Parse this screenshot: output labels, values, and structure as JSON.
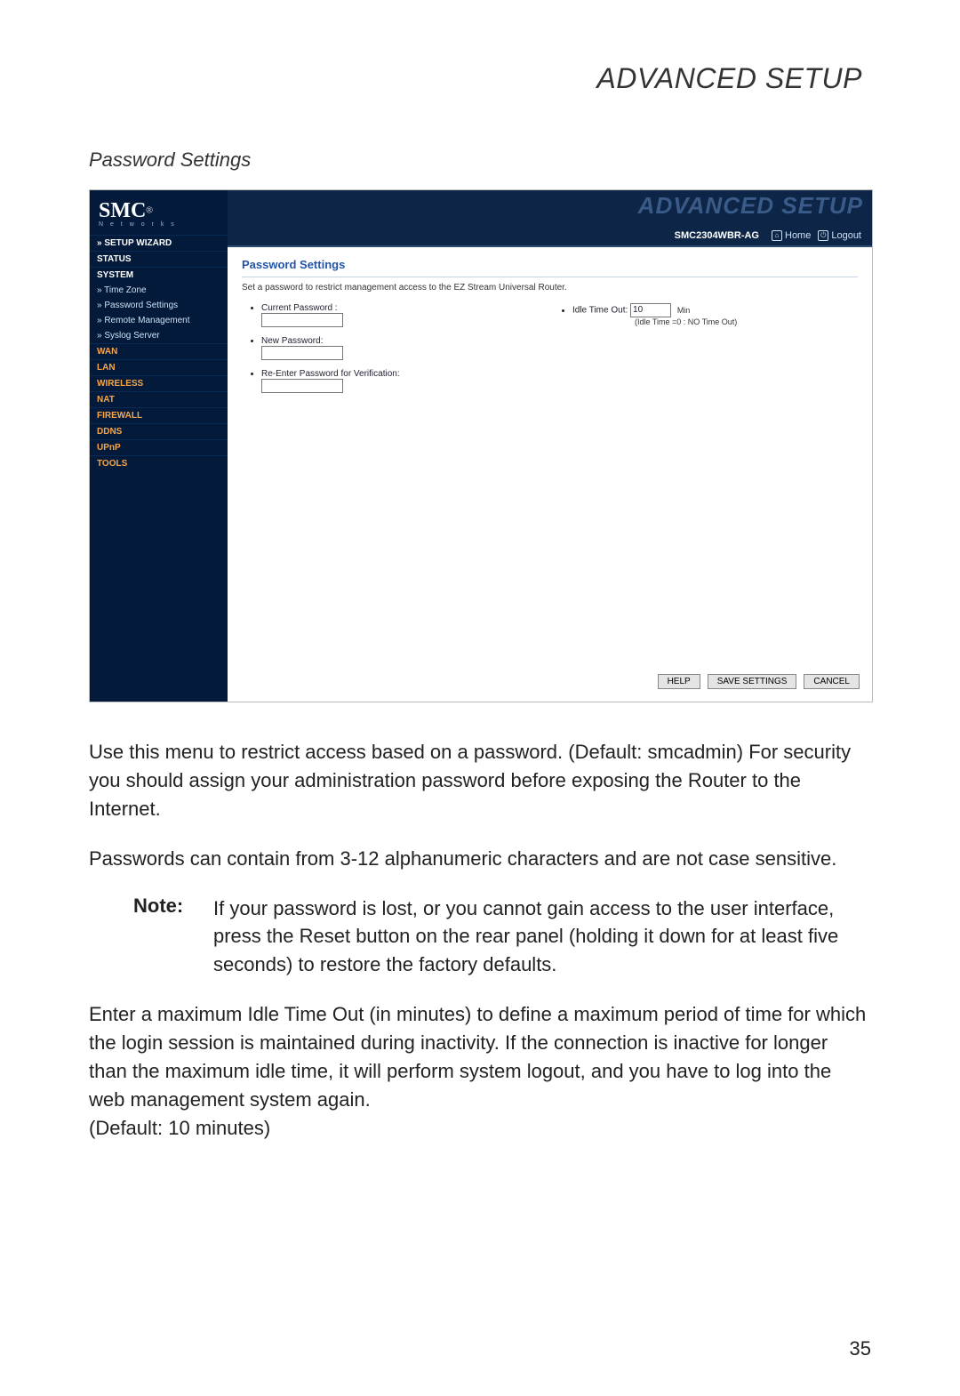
{
  "header": {
    "title": "ADVANCED SETUP"
  },
  "section": {
    "title": "Password Settings"
  },
  "router": {
    "logo": {
      "brand": "SMC",
      "reg": "®",
      "sub": "N e t w o r k s"
    },
    "banner": {
      "big": "ADVANCED SETUP",
      "model": "SMC2304WBR-AG",
      "home": "Home",
      "logout": "Logout"
    },
    "nav": {
      "setup_wizard": "» SETUP WIZARD",
      "status": "STATUS",
      "system": "SYSTEM",
      "time_zone": "» Time Zone",
      "password_settings": "» Password Settings",
      "remote_mgmt": "» Remote Management",
      "syslog": "» Syslog Server",
      "wan": "WAN",
      "lan": "LAN",
      "wireless": "WIRELESS",
      "nat": "NAT",
      "firewall": "FIREWALL",
      "ddns": "DDNS",
      "upnp": "UPnP",
      "tools": "TOOLS"
    },
    "panel": {
      "title": "Password Settings",
      "desc": "Set a password to restrict management access to the EZ Stream Universal Router.",
      "current_pw": "Current Password :",
      "new_pw": "New Password:",
      "reenter_pw": "Re-Enter Password for Verification:",
      "idle_label": "Idle Time Out:",
      "idle_value": "10",
      "idle_unit": "Min",
      "idle_hint": "(Idle Time =0 : NO Time Out)"
    },
    "buttons": {
      "help": "HELP",
      "save": "SAVE SETTINGS",
      "cancel": "CANCEL"
    }
  },
  "paragraphs": {
    "p1": "Use this menu to restrict access based on a password. (Default: smcadmin) For security you should assign your administration password before exposing the Router to the Internet.",
    "p2": "Passwords can contain from 3-12 alphanumeric characters and are not case sensitive.",
    "note_label": "Note:",
    "note_text": "If your password is lost, or you cannot gain access to the user interface, press the Reset button on the rear panel (holding it down for at least five seconds) to restore the factory defaults.",
    "p3": "Enter a maximum Idle Time Out (in minutes) to define a maximum period of time for which the login session is maintained during inactivity. If the connection is inactive for longer than the maximum idle time, it will perform system logout, and you have to log into the web management system again.\n(Default: 10 minutes)"
  },
  "page_number": "35"
}
